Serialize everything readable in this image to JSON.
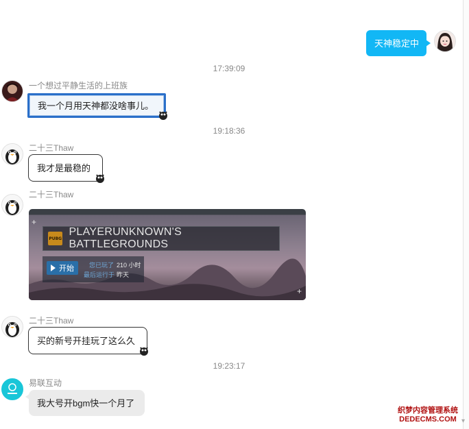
{
  "messages": {
    "self_text": "天神稳定中",
    "time1": "17:39:09",
    "m1_nick": "一个想过平静生活的上班族",
    "m1_text": "我一个月用天神都没啥事儿。",
    "time2": "19:18:36",
    "m2_nick": "二十三Thaw",
    "m2_text": "我才是最稳的",
    "m3_nick": "二十三Thaw",
    "m4_nick": "二十三Thaw",
    "m4_text": "买的新号开挂玩了这么久",
    "time3": "19:23:17",
    "m5_nick": "易联互动",
    "m5_text": "我大号开bgm快一个月了"
  },
  "game_card": {
    "logo_text": "PUBG",
    "title": "PLAYERUNKNOWN'S BATTLEGROUNDS",
    "play_label": "开始",
    "played_key": "您已玩了",
    "played_value": "210 小时",
    "last_run_key": "最后运行于",
    "last_run_value": "昨天"
  },
  "watermark": {
    "line1": "织梦内容管理系统",
    "line2": "DEDECMS.COM"
  },
  "colors": {
    "self_bubble": "#12b7f5",
    "framed_border": "#2a6fc9",
    "timestamp": "#888888"
  },
  "icons": [
    "expand-icon",
    "play-icon",
    "scroll-down-icon",
    "mascot-icon"
  ]
}
